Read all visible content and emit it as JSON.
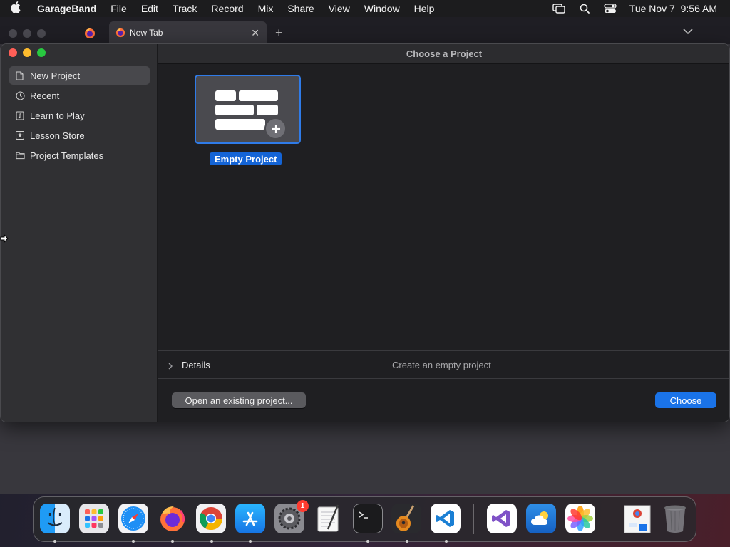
{
  "menubar": {
    "apple_icon": "apple-logo-icon",
    "app_name": "GarageBand",
    "menus": [
      "File",
      "Edit",
      "Track",
      "Record",
      "Mix",
      "Share",
      "View",
      "Window",
      "Help"
    ],
    "status_icons": [
      "screen-mirroring-icon",
      "search-icon",
      "control-center-icon"
    ],
    "clock": "Tue Nov 7  9:56 AM"
  },
  "browser": {
    "active_tab_title": "New Tab",
    "pinned_tab_icon": "firefox-icon",
    "new_tab_symbol": "+",
    "close_symbol": "✕"
  },
  "window": {
    "title": "Choose a Project",
    "sidebar": {
      "items": [
        {
          "label": "New Project",
          "icon": "document-icon",
          "selected": true
        },
        {
          "label": "Recent",
          "icon": "clock-icon",
          "selected": false
        },
        {
          "label": "Learn to Play",
          "icon": "music-book-icon",
          "selected": false
        },
        {
          "label": "Lesson Store",
          "icon": "star-icon",
          "selected": false
        },
        {
          "label": "Project Templates",
          "icon": "folder-icon",
          "selected": false
        }
      ]
    },
    "project": {
      "label": "Empty Project",
      "icon": "empty-project-icon"
    },
    "details": {
      "label": "Details",
      "description": "Create an empty project"
    },
    "buttons": {
      "open_existing": "Open an existing project...",
      "choose": "Choose"
    }
  },
  "dock": {
    "apps": [
      {
        "name": "Finder",
        "icon": "finder-icon",
        "running": true
      },
      {
        "name": "Launchpad",
        "icon": "launchpad-icon",
        "running": false
      },
      {
        "name": "Safari",
        "icon": "safari-icon",
        "running": true
      },
      {
        "name": "Firefox",
        "icon": "firefox-icon",
        "running": true
      },
      {
        "name": "Google Chrome",
        "icon": "chrome-icon",
        "running": true
      },
      {
        "name": "App Store",
        "icon": "app-store-icon",
        "running": true
      },
      {
        "name": "System Settings",
        "icon": "settings-icon",
        "running": false,
        "badge": "1"
      },
      {
        "name": "TextEdit",
        "icon": "textedit-icon",
        "running": false
      },
      {
        "name": "Terminal",
        "icon": "terminal-icon",
        "running": true
      },
      {
        "name": "GarageBand",
        "icon": "garageband-icon",
        "running": true
      },
      {
        "name": "Visual Studio Code",
        "icon": "vscode-icon",
        "running": true
      },
      {
        "name": "Visual Studio",
        "icon": "visual-studio-icon",
        "running": false
      },
      {
        "name": "Weather",
        "icon": "weather-icon",
        "running": false
      },
      {
        "name": "Photos",
        "icon": "photos-icon",
        "running": false
      },
      {
        "name": "Downloads",
        "icon": "downloads-stack-icon",
        "running": false
      },
      {
        "name": "Trash",
        "icon": "trash-icon",
        "running": false
      }
    ]
  },
  "colors": {
    "accent": "#1a73e8",
    "selection": "#2f7be8",
    "window_bg": "#1f1f22",
    "sidebar_bg": "#303033"
  }
}
